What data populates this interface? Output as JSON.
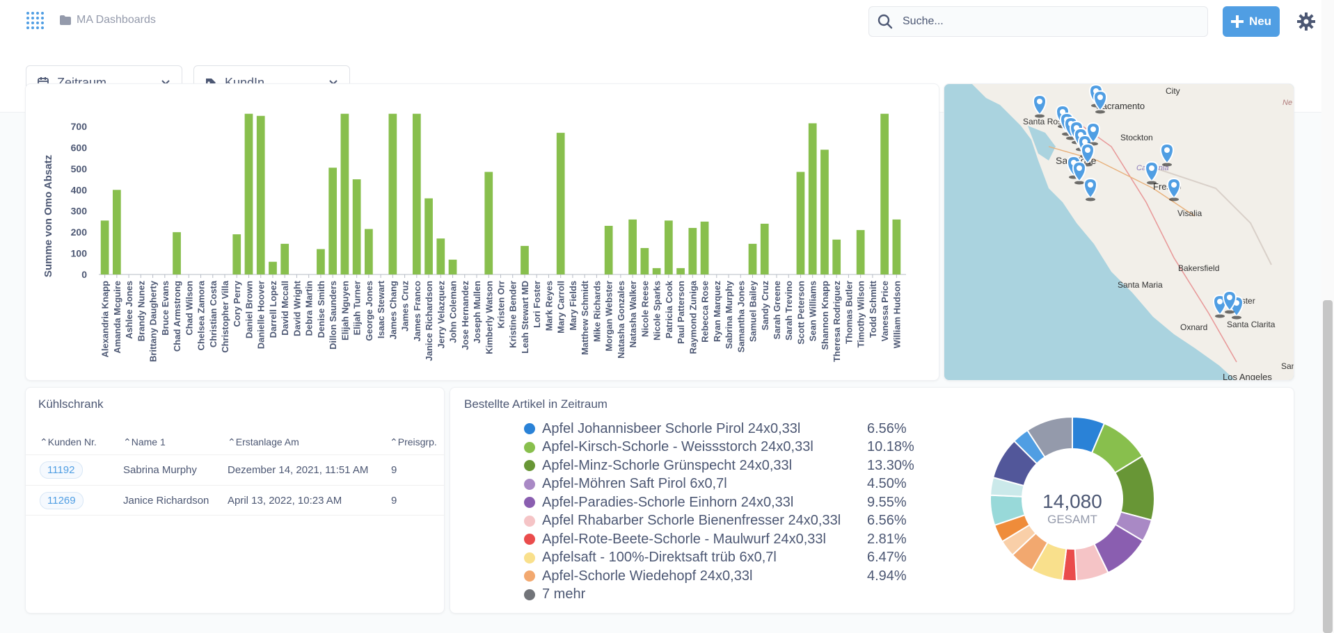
{
  "header": {
    "breadcrumb": "MA Dashboards",
    "search_placeholder": "Suche...",
    "new_label": "Neu"
  },
  "filters": [
    {
      "label": "Zeitraum",
      "icon": "calendar-icon"
    },
    {
      "label": "KundIn",
      "icon": "tag-icon"
    }
  ],
  "bar_card": {
    "chart_data": {
      "type": "bar",
      "ylabel": "Summe von Omo Absatz",
      "ylim": [
        0,
        760
      ],
      "yticks": [
        0,
        100,
        200,
        300,
        400,
        500,
        600,
        700
      ],
      "color": "#88bf4d",
      "categories": [
        "Alexandria Knapp",
        "Amanda Mcguire",
        "Ashlee Jones",
        "Brandy Nunez",
        "Brittany Daugherty",
        "Bruce Evans",
        "Chad Armstrong",
        "Chad Wilson",
        "Chelsea Zamora",
        "Christian Costa",
        "Christopher Villa",
        "Cory Perry",
        "Daniel Brown",
        "Danielle Hoover",
        "Darrell Lopez",
        "David Mccall",
        "David Wright",
        "Debra Martin",
        "Denise Smith",
        "Dillon Saunders",
        "Elijah Nguyen",
        "Elijah Turner",
        "George Jones",
        "Isaac Stewart",
        "James Chang",
        "James Cruz",
        "James Franco",
        "Janice Richardson",
        "Jerry Velazquez",
        "John Coleman",
        "Jose Hernandez",
        "Joseph Mullen",
        "Kimberly Watson",
        "Kristen Orr",
        "Kristine Bender",
        "Leah Stewart MD",
        "Lori Foster",
        "Mark Reyes",
        "Mary Carroll",
        "Mary Fields",
        "Matthew Schmidt",
        "Mike Richards",
        "Morgan Webster",
        "Natasha Gonzales",
        "Natasha Walker",
        "Nicole Reese",
        "Nicole Sparks",
        "Patricia Cook",
        "Paul Patterson",
        "Raymond Zuniga",
        "Rebecca Rose",
        "Ryan Marquez",
        "Sabrina Murphy",
        "Samantha Jones",
        "Samuel Bailey",
        "Sandy Cruz",
        "Sarah Greene",
        "Sarah Trevino",
        "Scott Peterson",
        "Sean Williams",
        "Shannon Knapp",
        "Theresa Rodriguez",
        "Thomas Butler",
        "Timothy Wilson",
        "Todd Schmitt",
        "Vanessa Price",
        "William Hudson"
      ],
      "values": [
        255,
        400,
        0,
        0,
        0,
        0,
        200,
        0,
        0,
        0,
        0,
        190,
        760,
        750,
        60,
        145,
        0,
        0,
        120,
        505,
        760,
        450,
        215,
        0,
        760,
        0,
        760,
        360,
        170,
        70,
        0,
        0,
        485,
        0,
        0,
        135,
        0,
        0,
        670,
        0,
        0,
        0,
        230,
        0,
        260,
        125,
        30,
        255,
        30,
        220,
        250,
        0,
        0,
        0,
        145,
        240,
        0,
        0,
        485,
        715,
        590,
        165,
        0,
        210,
        0,
        760,
        260
      ]
    }
  },
  "map_card": {
    "labels": [
      "Sacramento",
      "City",
      "Santa Rosa",
      "Stockton",
      "San Jose",
      "California",
      "Fresno",
      "Visalia",
      "Bakersfield",
      "Santa Maria",
      "Lancaster",
      "Oxnard",
      "Santa Clarita",
      "Los Angeles",
      "San",
      "Ne"
    ]
  },
  "table_card": {
    "title": "Kühlschrank",
    "columns": [
      "Kunden Nr.",
      "Name 1",
      "Erstanlage Am",
      "Preisgrp."
    ],
    "rows": [
      {
        "id": "11192",
        "name": "Sabrina Murphy",
        "date": "Dezember 14, 2021, 11:51 AM",
        "group": "9"
      },
      {
        "id": "11269",
        "name": "Janice Richardson",
        "date": "April 13, 2022, 10:23 AM",
        "group": "9"
      }
    ]
  },
  "pie_card": {
    "title": "Bestellte Artikel in Zeitraum",
    "total": "14,080",
    "total_label": "GESAMT",
    "chart_data": {
      "type": "pie",
      "legend": [
        {
          "name": "Apfel Johannisbeer Schorle Pirol 24x0,33l",
          "pct": "6.56%",
          "value": 6.56,
          "color": "#2a82d7"
        },
        {
          "name": "Apfel-Kirsch-Schorle - Weissstorch 24x0,33l",
          "pct": "10.18%",
          "value": 10.18,
          "color": "#88bf4d"
        },
        {
          "name": "Apfel-Minz-Schorle Grünspecht 24x0,33l",
          "pct": "13.30%",
          "value": 13.3,
          "color": "#689636"
        },
        {
          "name": "Apfel-Möhren Saft Pirol 6x0,7l",
          "pct": "4.50%",
          "value": 4.5,
          "color": "#a989c5"
        },
        {
          "name": "Apfel-Paradies-Schorle Einhorn 24x0,33l",
          "pct": "9.55%",
          "value": 9.55,
          "color": "#8a5eb0"
        },
        {
          "name": "Apfel Rhabarber Schorle Bienenfresser 24x0,33l",
          "pct": "6.56%",
          "value": 6.56,
          "color": "#f5c4c6"
        },
        {
          "name": "Apfel-Rote-Beete-Schorle - Maulwurf 24x0,33l",
          "pct": "2.81%",
          "value": 2.81,
          "color": "#ea4c4c"
        },
        {
          "name": "Apfelsaft - 100%-Direktsaft trüb 6x0,7l",
          "pct": "6.47%",
          "value": 6.47,
          "color": "#f9e08c"
        },
        {
          "name": "Apfel-Schorle Wiedehopf 24x0,33l",
          "pct": "4.94%",
          "value": 4.94,
          "color": "#f2a86f"
        },
        {
          "name": "7 mehr",
          "pct": "",
          "value": 0,
          "color": "#727479"
        }
      ],
      "extra_slices": [
        {
          "value": 3.4,
          "color": "#f9cfa8"
        },
        {
          "value": 3.6,
          "color": "#ef8c3a"
        },
        {
          "value": 6.1,
          "color": "#98d9d9"
        },
        {
          "value": 3.6,
          "color": "#cbe9ea"
        },
        {
          "value": 8.5,
          "color": "#52579a"
        },
        {
          "value": 3.4,
          "color": "#509ee3"
        },
        {
          "value": 9.5,
          "color": "#949aab"
        }
      ]
    }
  }
}
